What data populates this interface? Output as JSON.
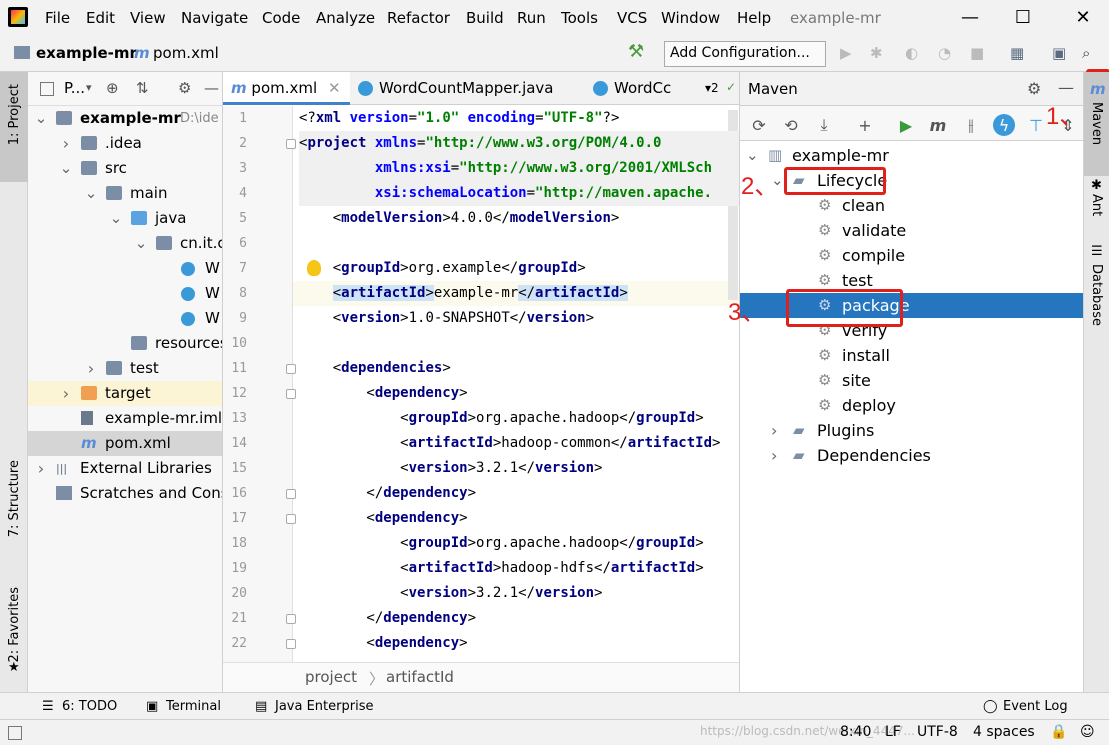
{
  "menu": [
    "File",
    "Edit",
    "View",
    "Navigate",
    "Code",
    "Analyze",
    "Refactor",
    "Build",
    "Run",
    "Tools",
    "VCS",
    "Window",
    "Help"
  ],
  "window_title": "example-mr",
  "nav": {
    "project": "example-mr",
    "file": "pom.xml",
    "add_config": "Add Configuration..."
  },
  "left_tabs": {
    "project": "1: Project",
    "structure": "7: Structure",
    "favorites": "2: Favorites"
  },
  "project_panel": {
    "title": "P...",
    "tree": [
      {
        "label": "example-mr",
        "extra": "D:\\ide",
        "indent": 0,
        "arrow": "down",
        "icon": "folder"
      },
      {
        "label": ".idea",
        "indent": 1,
        "arrow": "right",
        "icon": "folder"
      },
      {
        "label": "src",
        "indent": 1,
        "arrow": "down",
        "icon": "folder"
      },
      {
        "label": "main",
        "indent": 2,
        "arrow": "down",
        "icon": "folder"
      },
      {
        "label": "java",
        "indent": 3,
        "arrow": "down",
        "icon": "folder-blue"
      },
      {
        "label": "cn.it.c",
        "indent": 4,
        "arrow": "down",
        "icon": "folder"
      },
      {
        "label": "W",
        "indent": 5,
        "arrow": "",
        "icon": "class"
      },
      {
        "label": "W",
        "indent": 5,
        "arrow": "",
        "icon": "class"
      },
      {
        "label": "W",
        "indent": 5,
        "arrow": "",
        "icon": "class"
      },
      {
        "label": "resources",
        "indent": 3,
        "arrow": "",
        "icon": "folder"
      },
      {
        "label": "test",
        "indent": 2,
        "arrow": "right",
        "icon": "folder"
      },
      {
        "label": "target",
        "indent": 1,
        "arrow": "right",
        "icon": "folder-orange",
        "row": "yellow"
      },
      {
        "label": "example-mr.iml",
        "indent": 1,
        "arrow": "",
        "icon": "file"
      },
      {
        "label": "pom.xml",
        "indent": 1,
        "arrow": "",
        "icon": "maven",
        "row": "selected"
      },
      {
        "label": "External Libraries",
        "indent": 0,
        "arrow": "right",
        "icon": "lib"
      },
      {
        "label": "Scratches and Conso",
        "indent": 0,
        "arrow": "",
        "icon": "scratch"
      }
    ]
  },
  "editor": {
    "tabs": [
      "pom.xml",
      "WordCountMapper.java",
      "WordCc"
    ],
    "tab_overflow": "▾2",
    "lines": [
      {
        "n": "1",
        "html": [
          [
            "t",
            "<?"
          ],
          [
            "tg",
            "xml "
          ],
          [
            "at",
            "version"
          ],
          [
            "t",
            "="
          ],
          [
            "st",
            "\"1.0\""
          ],
          [
            "t",
            " "
          ],
          [
            "at",
            "encoding"
          ],
          [
            "t",
            "="
          ],
          [
            "st",
            "\"UTF-8\""
          ],
          [
            "t",
            "?>"
          ]
        ]
      },
      {
        "n": "2",
        "html": [
          [
            "t",
            "<"
          ],
          [
            "tg",
            "project "
          ],
          [
            "at",
            "xmlns"
          ],
          [
            "t",
            "="
          ],
          [
            "st",
            "\"http://www.w3.org/POM/4.0.0"
          ]
        ]
      },
      {
        "n": "3",
        "html": [
          [
            "t",
            "         "
          ],
          [
            "at",
            "xmlns:xsi"
          ],
          [
            "t",
            "="
          ],
          [
            "st",
            "\"http://www.w3.org/2001/XMLSch"
          ]
        ]
      },
      {
        "n": "4",
        "html": [
          [
            "t",
            "         "
          ],
          [
            "at",
            "xsi:schemaLocation"
          ],
          [
            "t",
            "="
          ],
          [
            "st",
            "\"http://maven.apache."
          ]
        ]
      },
      {
        "n": "5",
        "html": [
          [
            "t",
            "    <"
          ],
          [
            "tg",
            "modelVersion"
          ],
          [
            "t",
            ">4.0.0</"
          ],
          [
            "tg",
            "modelVersion"
          ],
          [
            "t",
            ">"
          ]
        ]
      },
      {
        "n": "6",
        "html": []
      },
      {
        "n": "7",
        "html": [
          [
            "t",
            "    <"
          ],
          [
            "tg",
            "groupId"
          ],
          [
            "t",
            ">org.example</"
          ],
          [
            "tg",
            "groupId"
          ],
          [
            "t",
            ">"
          ]
        ]
      },
      {
        "n": "8",
        "html": [
          [
            "t",
            "    "
          ],
          [
            "h",
            "<"
          ],
          [
            "htg",
            "artifactId"
          ],
          [
            "h",
            ">"
          ],
          [
            "t",
            "example-mr"
          ],
          [
            "h",
            "</"
          ],
          [
            "htg",
            "artifactId"
          ],
          [
            "h",
            ">"
          ]
        ]
      },
      {
        "n": "9",
        "html": [
          [
            "t",
            "    <"
          ],
          [
            "tg",
            "version"
          ],
          [
            "t",
            ">1.0-SNAPSHOT</"
          ],
          [
            "tg",
            "version"
          ],
          [
            "t",
            ">"
          ]
        ]
      },
      {
        "n": "10",
        "html": []
      },
      {
        "n": "11",
        "html": [
          [
            "t",
            "    <"
          ],
          [
            "tg",
            "dependencies"
          ],
          [
            "t",
            ">"
          ]
        ]
      },
      {
        "n": "12",
        "html": [
          [
            "t",
            "        <"
          ],
          [
            "tg",
            "dependency"
          ],
          [
            "t",
            ">"
          ]
        ]
      },
      {
        "n": "13",
        "html": [
          [
            "t",
            "            <"
          ],
          [
            "tg",
            "groupId"
          ],
          [
            "t",
            ">org.apache.hadoop</"
          ],
          [
            "tg",
            "groupId"
          ],
          [
            "t",
            ">"
          ]
        ]
      },
      {
        "n": "14",
        "html": [
          [
            "t",
            "            <"
          ],
          [
            "tg",
            "artifactId"
          ],
          [
            "t",
            ">hadoop-common</"
          ],
          [
            "tg",
            "artifactId"
          ],
          [
            "t",
            ">"
          ]
        ]
      },
      {
        "n": "15",
        "html": [
          [
            "t",
            "            <"
          ],
          [
            "tg",
            "version"
          ],
          [
            "t",
            ">3.2.1</"
          ],
          [
            "tg",
            "version"
          ],
          [
            "t",
            ">"
          ]
        ]
      },
      {
        "n": "16",
        "html": [
          [
            "t",
            "        </"
          ],
          [
            "tg",
            "dependency"
          ],
          [
            "t",
            ">"
          ]
        ]
      },
      {
        "n": "17",
        "html": [
          [
            "t",
            "        <"
          ],
          [
            "tg",
            "dependency"
          ],
          [
            "t",
            ">"
          ]
        ]
      },
      {
        "n": "18",
        "html": [
          [
            "t",
            "            <"
          ],
          [
            "tg",
            "groupId"
          ],
          [
            "t",
            ">org.apache.hadoop</"
          ],
          [
            "tg",
            "groupId"
          ],
          [
            "t",
            ">"
          ]
        ]
      },
      {
        "n": "19",
        "html": [
          [
            "t",
            "            <"
          ],
          [
            "tg",
            "artifactId"
          ],
          [
            "t",
            ">hadoop-hdfs</"
          ],
          [
            "tg",
            "artifactId"
          ],
          [
            "t",
            ">"
          ]
        ]
      },
      {
        "n": "20",
        "html": [
          [
            "t",
            "            <"
          ],
          [
            "tg",
            "version"
          ],
          [
            "t",
            ">3.2.1</"
          ],
          [
            "tg",
            "version"
          ],
          [
            "t",
            ">"
          ]
        ]
      },
      {
        "n": "21",
        "html": [
          [
            "t",
            "        </"
          ],
          [
            "tg",
            "dependency"
          ],
          [
            "t",
            ">"
          ]
        ]
      },
      {
        "n": "22",
        "html": [
          [
            "t",
            "        <"
          ],
          [
            "tg",
            "dependency"
          ],
          [
            "t",
            ">"
          ]
        ]
      }
    ],
    "breadcrumb": [
      "project",
      "artifactId"
    ]
  },
  "maven": {
    "title": "Maven",
    "tree": [
      {
        "label": "example-mr",
        "indent": 0,
        "arrow": "down",
        "icon": "maven"
      },
      {
        "label": "Lifecycle",
        "indent": 1,
        "arrow": "down",
        "icon": "folder"
      },
      {
        "label": "clean",
        "indent": 2,
        "icon": "gear"
      },
      {
        "label": "validate",
        "indent": 2,
        "icon": "gear"
      },
      {
        "label": "compile",
        "indent": 2,
        "icon": "gear"
      },
      {
        "label": "test",
        "indent": 2,
        "icon": "gear"
      },
      {
        "label": "package",
        "indent": 2,
        "icon": "gear",
        "selected": true
      },
      {
        "label": "verify",
        "indent": 2,
        "icon": "gear"
      },
      {
        "label": "install",
        "indent": 2,
        "icon": "gear"
      },
      {
        "label": "site",
        "indent": 2,
        "icon": "gear"
      },
      {
        "label": "deploy",
        "indent": 2,
        "icon": "gear"
      },
      {
        "label": "Plugins",
        "indent": 1,
        "arrow": "right",
        "icon": "folder"
      },
      {
        "label": "Dependencies",
        "indent": 1,
        "arrow": "right",
        "icon": "folder"
      }
    ],
    "annotations": [
      "1、",
      "2、",
      "3、"
    ]
  },
  "right_tabs": {
    "maven": "Maven",
    "ant": "Ant",
    "database": "Database"
  },
  "bottom_tabs": {
    "todo": "6: TODO",
    "terminal": "Terminal",
    "javaee": "Java Enterprise",
    "eventlog": "Event Log"
  },
  "status": {
    "pos": "8:40",
    "lf": "LF",
    "enc": "UTF-8",
    "indent": "4 spaces",
    "watermark": "https://blog.csdn.net/weixin_4447..."
  },
  "colors": {
    "accent": "#2675bf",
    "annotation": "#e0201a"
  }
}
